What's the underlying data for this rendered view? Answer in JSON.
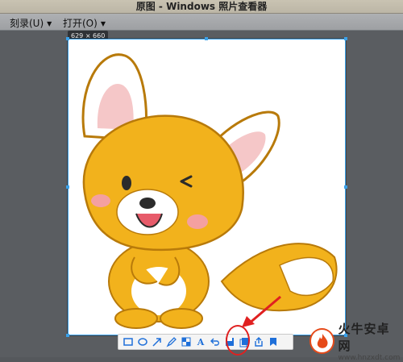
{
  "window": {
    "title": "原图 - Windows 照片查看器"
  },
  "menu": [
    {
      "label": "刻录(U)"
    },
    {
      "label": "打开(O)"
    }
  ],
  "image": {
    "dimensions_label": "629 × 660"
  },
  "toolbar": {
    "items": [
      "rectangle-icon",
      "ellipse-icon",
      "arrow-icon",
      "pen-icon",
      "mosaic-icon",
      "text-icon",
      "undo-icon",
      "save-icon",
      "copy-icon",
      "share-icon",
      "pin-icon"
    ],
    "text_tool_label": "A"
  },
  "watermark": {
    "title": "火牛安卓网",
    "url": "www.hnzxdt.com"
  },
  "colors": {
    "accent": "#1e6fd9",
    "selection": "#3aa0e8",
    "annotation": "#e02020",
    "fox": "#f2b21c"
  }
}
